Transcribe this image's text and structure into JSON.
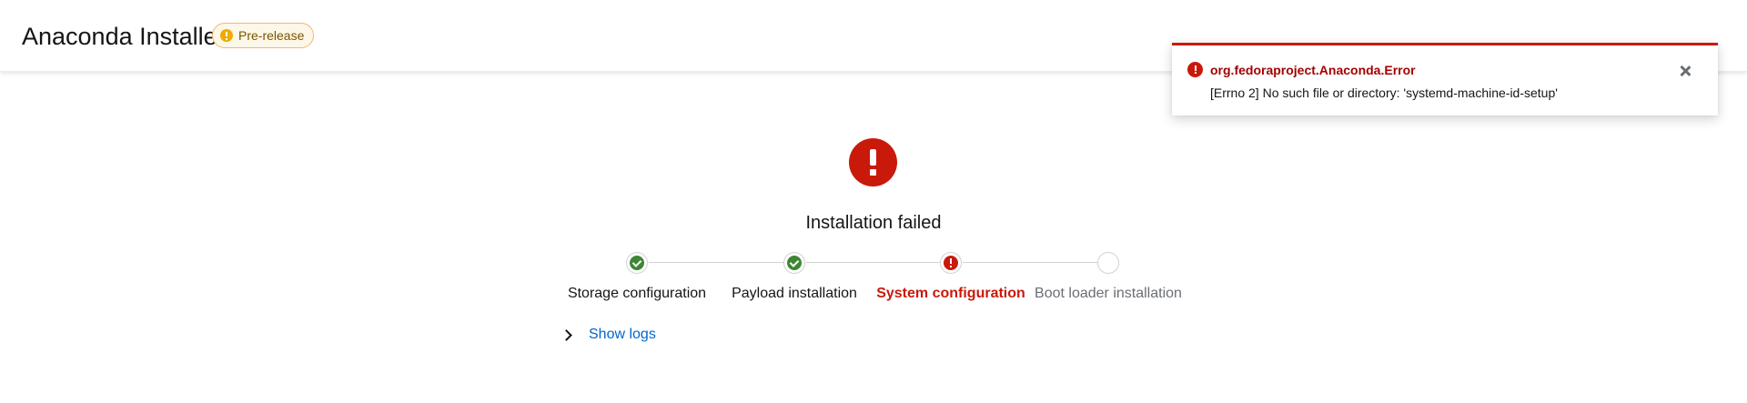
{
  "header": {
    "title": "Anaconda Installer",
    "badge": {
      "label": "Pre-release",
      "icon": "info-icon",
      "color": "#f0ab00"
    }
  },
  "toast": {
    "icon": "exclamation-circle-icon",
    "title": "org.fedoraproject.Anaconda.Error",
    "message": "[Errno 2] No such file or directory: 'systemd-machine-id-setup'",
    "close_icon": "close-icon",
    "color": "#c9190b"
  },
  "status": {
    "icon": "exclamation-circle-icon",
    "title": "Installation failed"
  },
  "steps": [
    {
      "label": "Storage configuration",
      "state": "success"
    },
    {
      "label": "Payload installation",
      "state": "success"
    },
    {
      "label": "System configuration",
      "state": "error"
    },
    {
      "label": "Boot loader installation",
      "state": "pending"
    }
  ],
  "logs": {
    "label": "Show logs",
    "icon": "chevron-right-icon"
  },
  "colors": {
    "success": "#3e8635",
    "danger": "#c9190b",
    "link": "#0066cc"
  }
}
